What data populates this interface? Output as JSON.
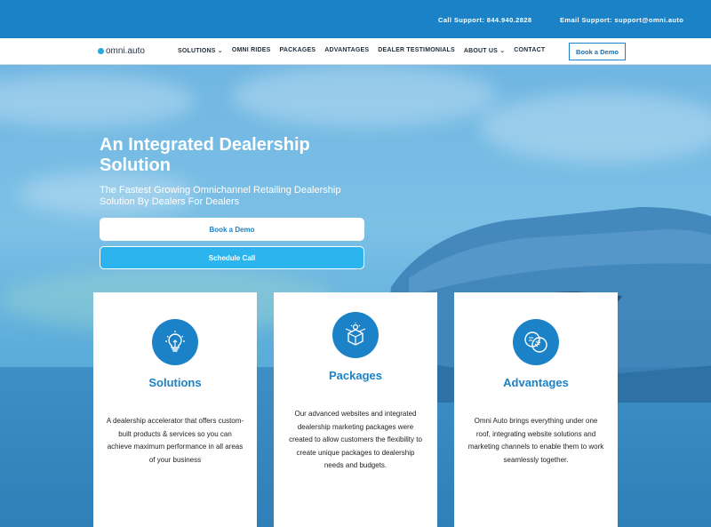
{
  "topbar": {
    "call_support": "Call Support: 844.940.2828",
    "email_support": "Email Support: support@omni.auto"
  },
  "nav": {
    "logo_text": "omni.auto",
    "items": [
      {
        "label": "SOLUTIONS",
        "dropdown": true
      },
      {
        "label": "OMNI RIDES",
        "dropdown": false
      },
      {
        "label": "PACKAGES",
        "dropdown": false
      },
      {
        "label": "ADVANTAGES",
        "dropdown": false
      },
      {
        "label": "DEALER TESTIMONIALS",
        "dropdown": false
      },
      {
        "label": "ABOUT US",
        "dropdown": true
      },
      {
        "label": "CONTACT",
        "dropdown": false
      }
    ],
    "cta_label": "Book a Demo"
  },
  "hero": {
    "title": "An Integrated Dealership Solution",
    "subtitle": "The Fastest Growing Omnichannel Retailing Dealership Solution By Dealers For Dealers",
    "book_demo_label": "Book a Demo",
    "schedule_call_label": "Schedule Call"
  },
  "cards": [
    {
      "icon": "lightbulb-icon",
      "title": "Solutions",
      "description": "A dealership accelerator that offers custom-built products & services so you can achieve maximum performance in all areas of your business"
    },
    {
      "icon": "package-box-icon",
      "title": "Packages",
      "description": "Our advanced websites and integrated dealership marketing packages were created to allow customers the flexibility to create unique packages to dealership needs and budgets."
    },
    {
      "icon": "venn-diagram-icon",
      "title": "Advantages",
      "description": "Omni Auto brings everything under one roof, integrating website solutions and marketing channels to enable them to work seamlessly together."
    }
  ],
  "colors": {
    "brand_blue": "#1b82c8",
    "cta_light_blue": "#2bb4ee",
    "white": "#ffffff"
  }
}
